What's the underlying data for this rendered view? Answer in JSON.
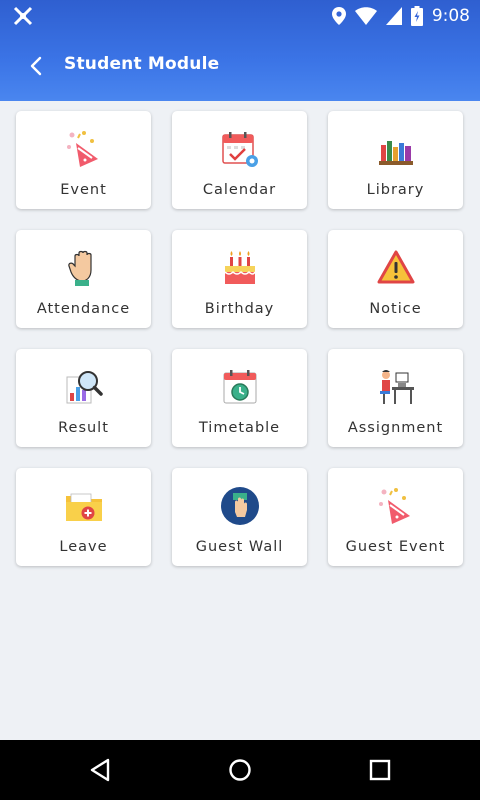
{
  "status_bar": {
    "time": "9:08"
  },
  "header": {
    "title": "Student Module",
    "back_icon": "back-arrow-icon"
  },
  "modules": [
    {
      "label": "Event",
      "icon": "party-popper-icon"
    },
    {
      "label": "Calendar",
      "icon": "calendar-icon"
    },
    {
      "label": "Library",
      "icon": "books-icon"
    },
    {
      "label": "Attendance",
      "icon": "raised-hand-icon"
    },
    {
      "label": "Birthday",
      "icon": "birthday-cake-icon"
    },
    {
      "label": "Notice",
      "icon": "warning-icon"
    },
    {
      "label": "Result",
      "icon": "chart-magnifier-icon"
    },
    {
      "label": "Timetable",
      "icon": "calendar-clock-icon"
    },
    {
      "label": "Assignment",
      "icon": "person-at-desk-icon"
    },
    {
      "label": "Leave",
      "icon": "folder-plus-icon"
    },
    {
      "label": "Guest Wall",
      "icon": "hand-badge-icon"
    },
    {
      "label": "Guest Event",
      "icon": "party-popper-icon"
    }
  ],
  "colors": {
    "header_start": "#2f5fd0",
    "header_end": "#4a86ef",
    "background": "#eef1f5"
  }
}
